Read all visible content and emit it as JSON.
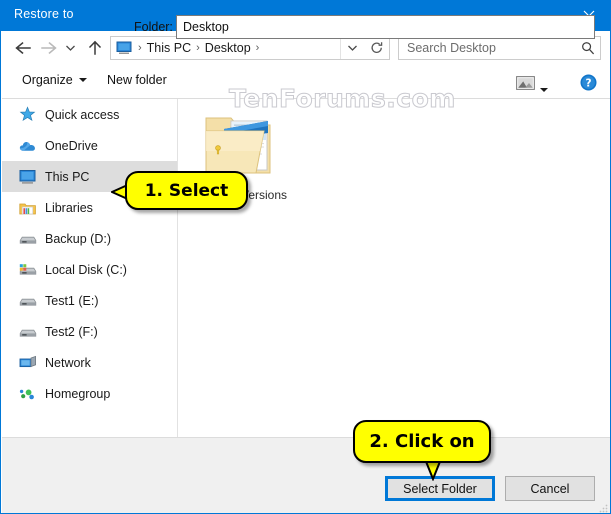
{
  "window": {
    "title": "Restore to",
    "close_icon": "close-icon",
    "accent_color": "#0078d7",
    "titlebar_color": "#0078d7"
  },
  "navbar": {
    "back_icon": "back-arrow-icon",
    "forward_icon": "forward-arrow-icon",
    "recent_icon": "recent-locations-chevron-icon",
    "up_icon": "up-arrow-icon",
    "address": {
      "root_icon": "this-pc-icon",
      "crumbs": [
        "This PC",
        "Desktop"
      ],
      "separator": "›",
      "dropdown_icon": "chevron-down-icon",
      "refresh_icon": "refresh-icon"
    },
    "search": {
      "placeholder": "Search Desktop",
      "icon": "search-icon"
    }
  },
  "toolbar": {
    "organize_label": "Organize",
    "new_folder_label": "New folder",
    "organize_caret_icon": "caret-down-icon",
    "view_icon": "change-view-icon",
    "view_caret_icon": "caret-down-icon",
    "help_icon": "help-icon"
  },
  "sidebar": {
    "items": [
      {
        "label": "Quick access",
        "icon": "star-icon",
        "selected": false
      },
      {
        "label": "OneDrive",
        "icon": "cloud-icon",
        "selected": false
      },
      {
        "label": "This PC",
        "icon": "monitor-icon",
        "selected": true
      },
      {
        "label": "Libraries",
        "icon": "libraries-icon",
        "selected": false
      },
      {
        "label": "Backup (D:)",
        "icon": "drive-icon",
        "selected": false
      },
      {
        "label": "Local Disk (C:)",
        "icon": "system-drive-icon",
        "selected": false
      },
      {
        "label": "Test1 (E:)",
        "icon": "drive-icon",
        "selected": false
      },
      {
        "label": "Test2 (F:)",
        "icon": "drive-icon",
        "selected": false
      },
      {
        "label": "Network",
        "icon": "network-icon",
        "selected": false
      },
      {
        "label": "Homegroup",
        "icon": "homegroup-icon",
        "selected": false
      }
    ]
  },
  "content": {
    "files": [
      {
        "name": "Previous Versions",
        "icon": "folder-icon"
      }
    ]
  },
  "watermark": {
    "text": "TenForums.com"
  },
  "footer": {
    "folder_label": "Folder:",
    "folder_value": "Desktop",
    "select_button": "Select Folder",
    "cancel_button": "Cancel",
    "resize_grip_icon": "resize-grip-icon"
  },
  "callouts": [
    {
      "id": "callout1",
      "text": "1. Select",
      "color": "#ffff00"
    },
    {
      "id": "callout2",
      "text": "2. Click on",
      "color": "#ffff00"
    }
  ]
}
